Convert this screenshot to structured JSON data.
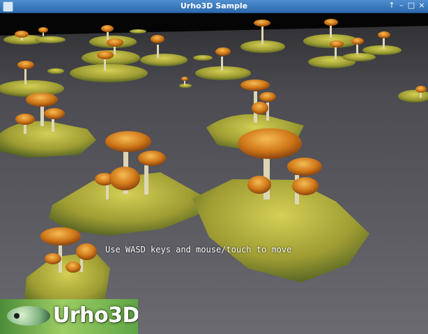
{
  "window": {
    "title": "Urho3D Sample",
    "controls": [
      "↑",
      "–",
      "□",
      "×"
    ]
  },
  "hud": {
    "instructions": "Use WASD keys and mouse/touch to move"
  },
  "logo": {
    "text": "Urho3D"
  },
  "colors": {
    "titlebar": "#2c68ad",
    "ground": "#595960",
    "moss": "#a5a33a",
    "mushroom_cap": "#d37d1b",
    "mushroom_stem": "#ddd6b6"
  },
  "icons": [
    "app-icon",
    "logo-fish-icon"
  ]
}
